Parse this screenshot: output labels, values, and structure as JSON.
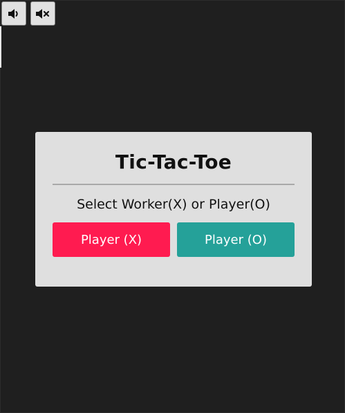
{
  "sound_controls": {
    "sound_on_icon": "speaker-on-icon",
    "sound_off_icon": "speaker-muted-icon"
  },
  "dialog": {
    "title": "Tic-Tac-Toe",
    "subtitle": "Select Worker(X) or Player(O)",
    "player_x_label": "Player (X)",
    "player_o_label": "Player (O)"
  },
  "colors": {
    "background": "#1f1f1f",
    "dialog_background": "#dfdfdf",
    "player_x": "#ff1b50",
    "player_o": "#25a199"
  }
}
